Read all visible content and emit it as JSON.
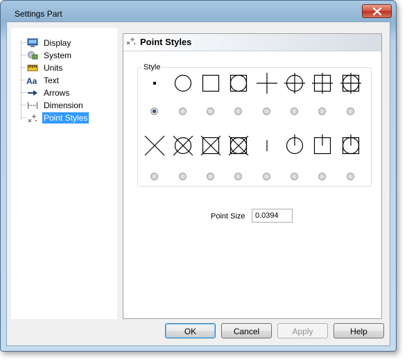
{
  "window": {
    "title": "Settings Part"
  },
  "tree": {
    "items": [
      {
        "label": "Display",
        "icon": "display-icon"
      },
      {
        "label": "System",
        "icon": "system-icon"
      },
      {
        "label": "Units",
        "icon": "units-icon"
      },
      {
        "label": "Text",
        "icon": "text-aa-icon"
      },
      {
        "label": "Arrows",
        "icon": "arrow-icon"
      },
      {
        "label": "Dimension",
        "icon": "dimension-icon"
      },
      {
        "label": "Point Styles",
        "icon": "point-styles-icon",
        "selected": true
      }
    ]
  },
  "panel": {
    "title": "Point Styles",
    "style_group_label": "Style",
    "selected_style_index": 0,
    "styles_row1": [
      "dot",
      "circle",
      "square",
      "circle-in-square",
      "plus",
      "circle-plus",
      "square-plus",
      "circle-square-plus"
    ],
    "styles_row2": [
      "x",
      "circle-x",
      "square-x",
      "circle-square-x",
      "tick",
      "circle-tick",
      "square-tick",
      "circle-square-tick"
    ],
    "point_size_label": "Point Size",
    "point_size_value": "0.0394"
  },
  "buttons": {
    "ok": "OK",
    "cancel": "Cancel",
    "apply": "Apply",
    "help": "Help"
  },
  "colors": {
    "selection": "#3399ff",
    "close_button": "#d1533e"
  }
}
